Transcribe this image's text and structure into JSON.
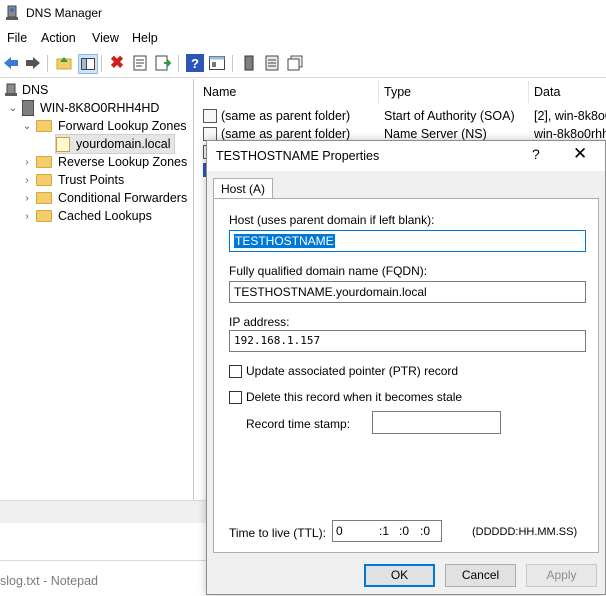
{
  "window": {
    "title": "DNS Manager"
  },
  "menu": {
    "file": "File",
    "action": "Action",
    "view": "View",
    "help": "Help"
  },
  "tree": {
    "root": "DNS",
    "server": "WIN-8K8O0RHH4HD",
    "forward": "Forward Lookup Zones",
    "zone": "yourdomain.local",
    "reverse": "Reverse Lookup Zones",
    "trust": "Trust Points",
    "conditional": "Conditional Forwarders",
    "cached": "Cached Lookups"
  },
  "list": {
    "columns": [
      "Name",
      "Type",
      "Data"
    ],
    "rows": [
      {
        "name": "(same as parent folder)",
        "type": "Start of Authority (SOA)",
        "data": "[2], win-8k8o0"
      },
      {
        "name": "(same as parent folder)",
        "type": "Name Server (NS)",
        "data": "win-8k8o0rhh"
      }
    ]
  },
  "taskbar": {
    "notepad": "slog.txt - Notepad"
  },
  "dialog": {
    "title": "TESTHOSTNAME Properties",
    "help_glyph": "?",
    "close_glyph": "✕",
    "tab": "Host (A)",
    "host_label": "Host (uses parent domain if left blank):",
    "host_value": "TESTHOSTNAME",
    "fqdn_label": "Fully qualified domain name (FQDN):",
    "fqdn_value": "TESTHOSTNAME.yourdomain.local",
    "ip_label": "IP address:",
    "ip_value": "192.168.1.157",
    "ptr_label": "Update associated pointer (PTR) record",
    "stale_label": "Delete this record when it becomes stale",
    "timestamp_label": "Record time stamp:",
    "ttl_label": "Time to live (TTL):",
    "ttl_days": "0",
    "ttl_hours": ":1",
    "ttl_minutes": ":0",
    "ttl_seconds": ":0",
    "ttl_format": "(DDDDD:HH.MM.SS)",
    "ok": "OK",
    "cancel": "Cancel",
    "apply": "Apply"
  },
  "colors": {
    "accent": "#0078d7",
    "folder": "#f3cd6a"
  }
}
